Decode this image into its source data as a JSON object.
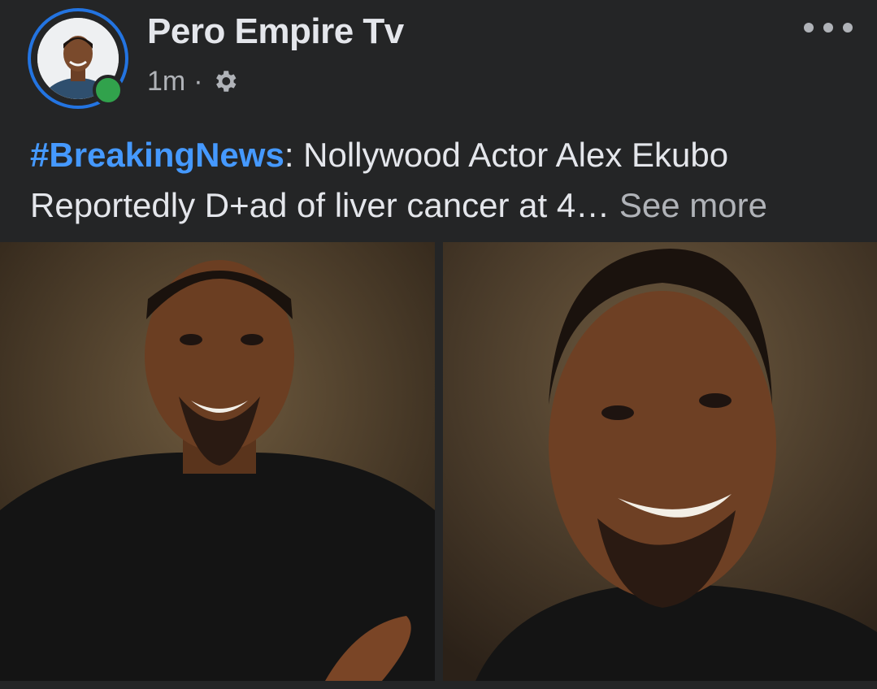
{
  "post": {
    "page_name": "Pero Empire Tv",
    "timestamp": "1m",
    "separator": "·",
    "privacy_icon": "gear-icon",
    "more_icon": "more-dots-icon",
    "hashtag": "#BreakingNews",
    "text_line1_rest": ": Nollywood Actor Alex Ekubo",
    "text_line2": "Reportedly D+ad of liver cancer at 4…",
    "see_more": "See more"
  },
  "colors": {
    "background": "#242526",
    "avatar_ring": "#2374e1",
    "online": "#31a24c",
    "hashtag": "#4599ff",
    "secondary_text": "#b0b3b8"
  },
  "photos": [
    {
      "id": "photo-left"
    },
    {
      "id": "photo-right"
    }
  ]
}
